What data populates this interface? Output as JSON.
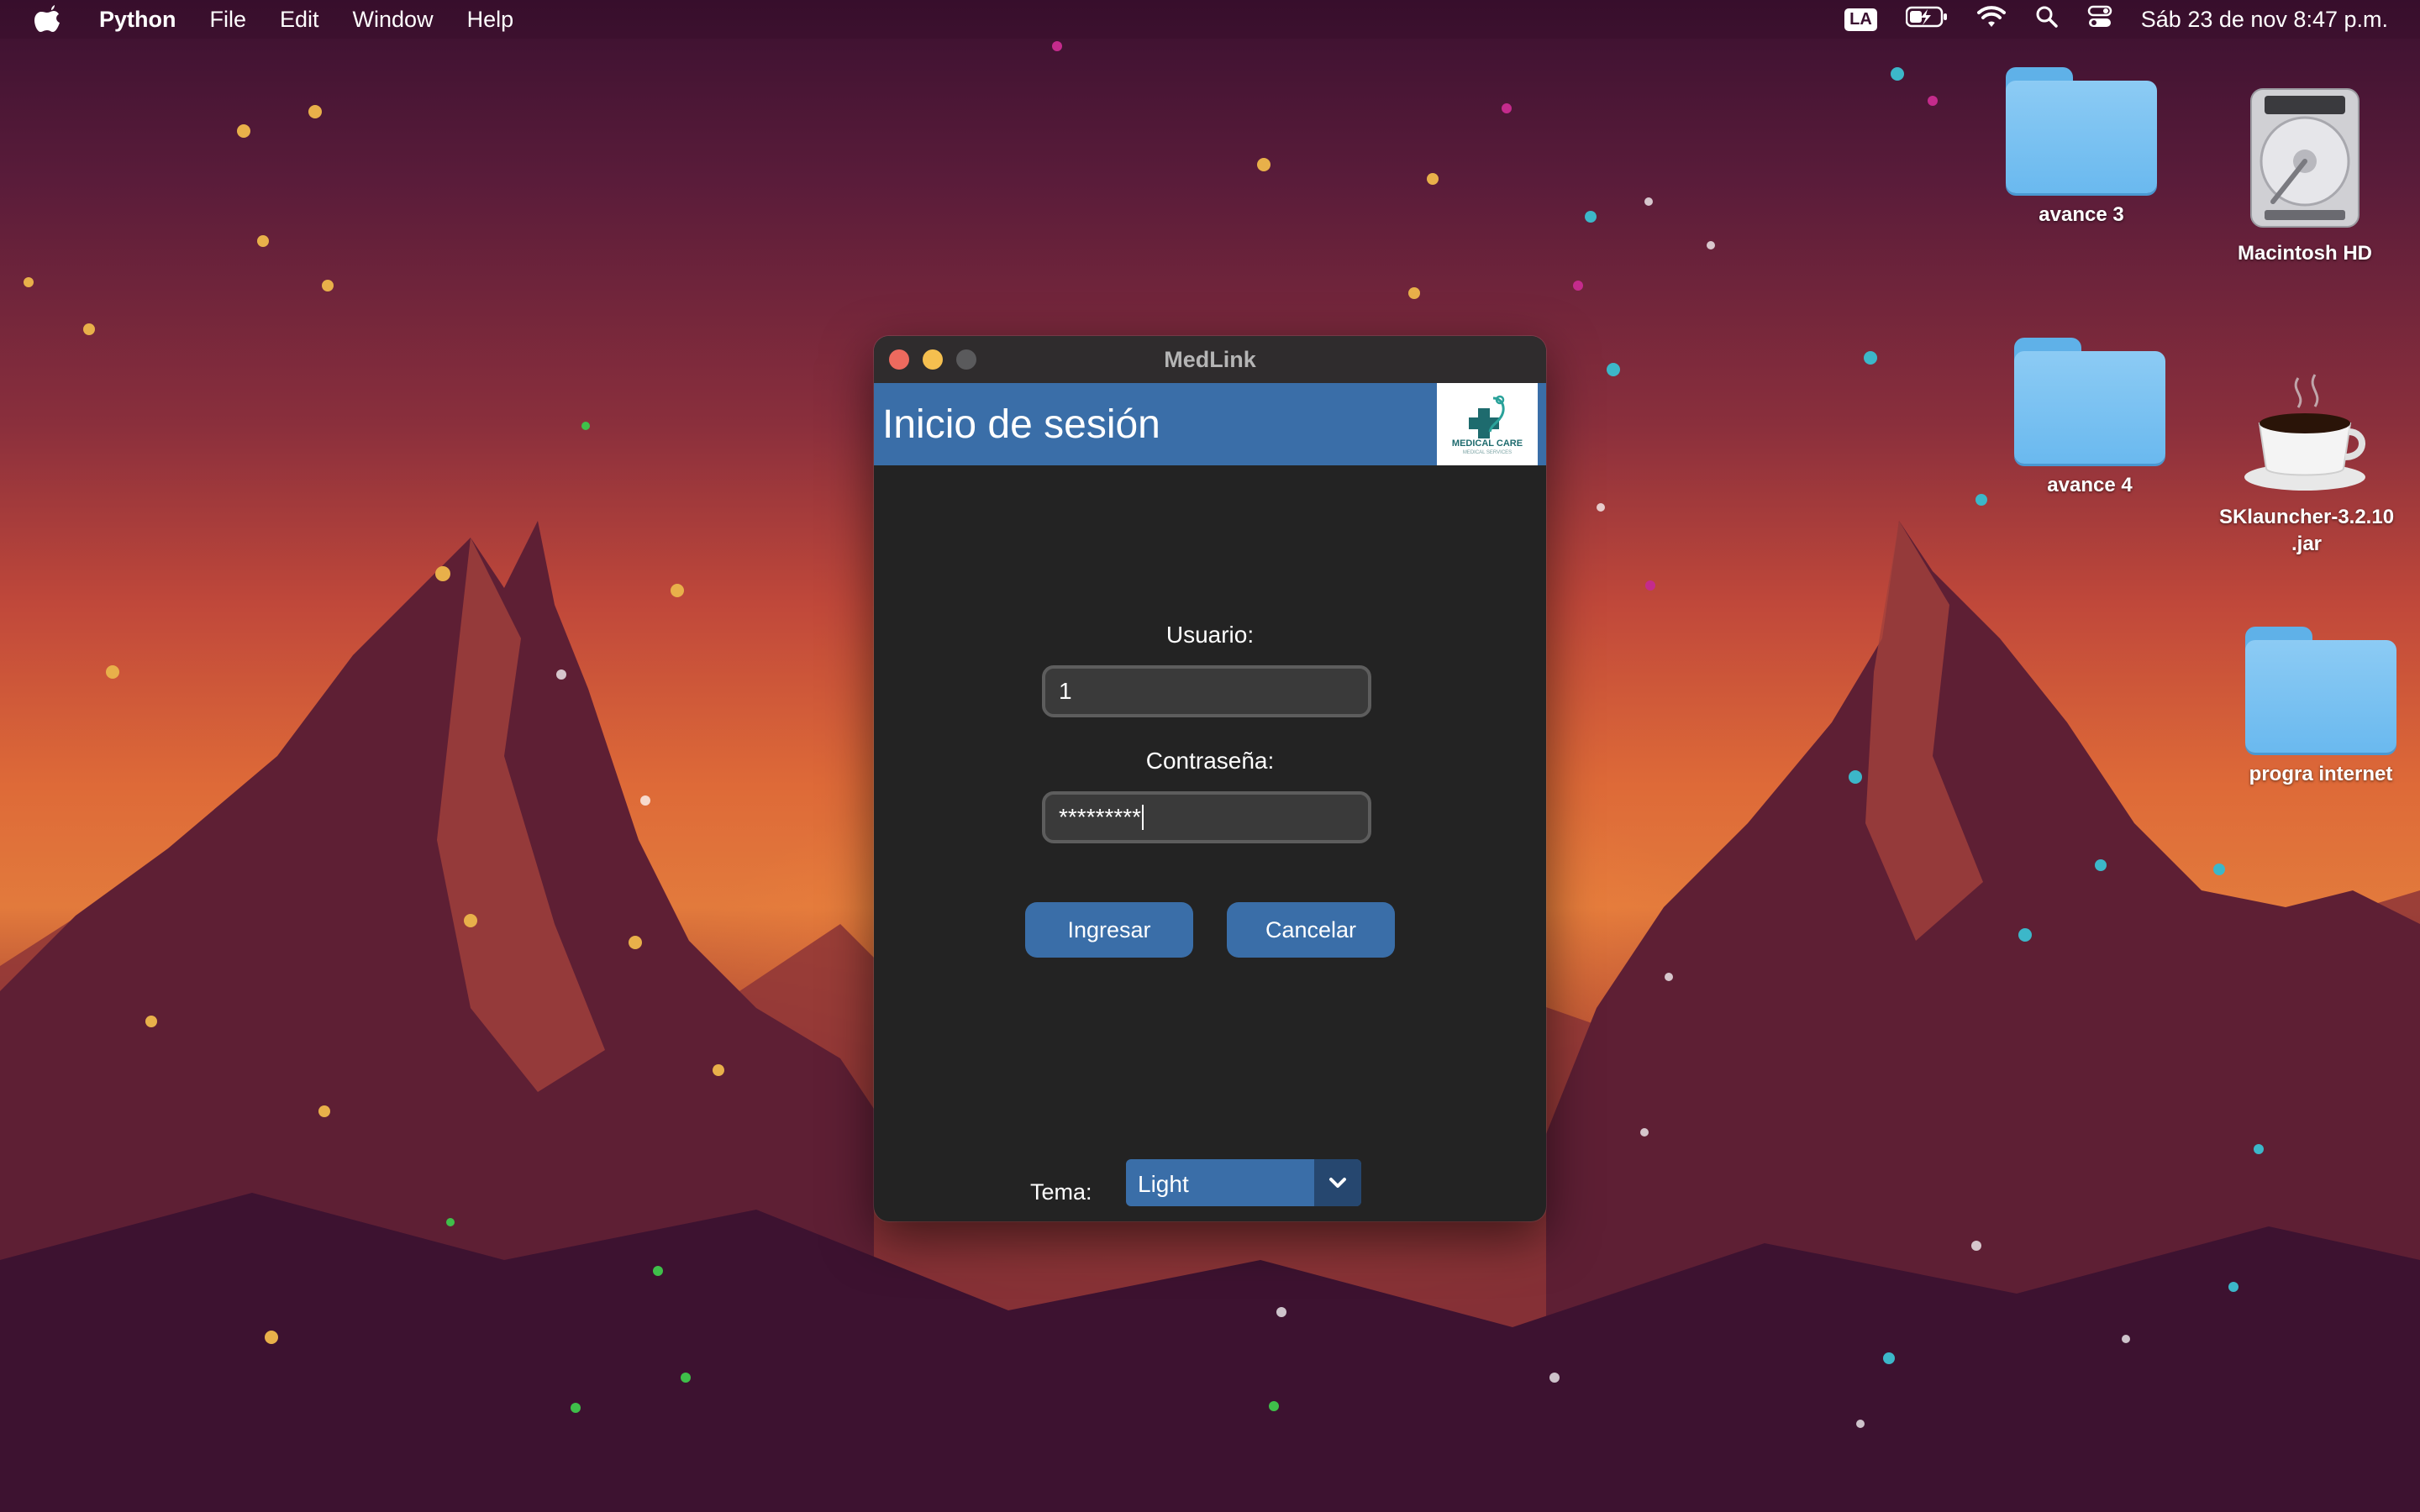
{
  "menubar": {
    "app_name": "Python",
    "items": [
      "File",
      "Edit",
      "Window",
      "Help"
    ],
    "input_badge": "LA",
    "datetime": "Sáb 23 de nov  8:47 p.m."
  },
  "desktop": {
    "icons": [
      {
        "label": "avance 3",
        "type": "folder"
      },
      {
        "label": "Macintosh HD",
        "type": "drive"
      },
      {
        "label": "avance 4",
        "type": "folder"
      },
      {
        "label": "SKlauncher-3.2.10\n.jar",
        "type": "java-app"
      },
      {
        "label": "progra internet",
        "type": "folder"
      }
    ]
  },
  "window": {
    "title": "MedLink",
    "header_title": "Inicio de sesión",
    "logo": {
      "text": "MEDICAL CARE",
      "subtext": "MEDICAL SERVICES"
    },
    "user_label": "Usuario:",
    "user_value": "1",
    "password_label": "Contraseña:",
    "password_value": "*********",
    "login_button": "Ingresar",
    "cancel_button": "Cancelar",
    "theme_label": "Tema:",
    "theme_value": "Light"
  },
  "colors": {
    "accent": "#3a6ea8",
    "window_bg": "#232323",
    "field_bg": "#3a3a3a"
  }
}
